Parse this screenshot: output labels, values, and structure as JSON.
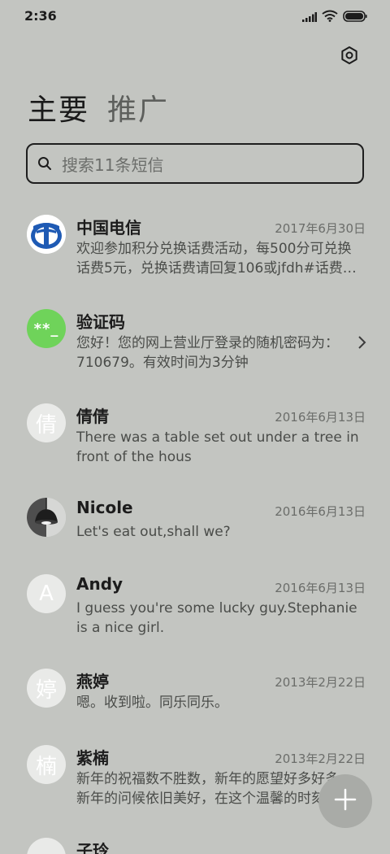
{
  "status_bar": {
    "time": "2:36",
    "icons": [
      "signal-icon",
      "wifi-icon",
      "battery-icon"
    ]
  },
  "header": {
    "settings_icon": "gear-icon"
  },
  "tabs": [
    {
      "label": "主要",
      "active": true
    },
    {
      "label": "推广",
      "active": false
    }
  ],
  "search": {
    "placeholder": "搜索11条短信",
    "icon": "search-icon"
  },
  "messages": [
    {
      "sender": "中国电信",
      "date": "2017年6月30日",
      "line1": "欢迎参加积分兑换话费活动，每500分可兑换",
      "line2": "话费5元，兑换话费请回复106或jfdh#话费…",
      "avatar": {
        "type": "logo",
        "name": "china-telecom-logo"
      }
    },
    {
      "sender": "验证码",
      "date": "",
      "line1": "您好！您的网上营业厅登录的随机密码为：",
      "line2": "710679。有效时间为3分钟",
      "avatar": {
        "type": "code",
        "text": "**_",
        "color": "#6fd35a"
      }
    },
    {
      "sender": "倩倩",
      "date": "2016年6月13日",
      "line1": "There was a table set out under a tree in",
      "line2": "front of the hous",
      "avatar": {
        "type": "letter",
        "text": "倩"
      }
    },
    {
      "sender": "Nicole",
      "date": "2016年6月13日",
      "line1": "Let's eat out,shall we?",
      "line2": "",
      "avatar": {
        "type": "photo",
        "name": "lamp-photo"
      }
    },
    {
      "sender": "Andy",
      "date": "2016年6月13日",
      "line1": "I guess you're some lucky guy.Stephanie",
      "line2": "is a nice girl.",
      "avatar": {
        "type": "letter",
        "text": "A"
      }
    },
    {
      "sender": "燕婷",
      "date": "2013年2月22日",
      "line1": "嗯。收到啦。同乐同乐。",
      "line2": "",
      "avatar": {
        "type": "letter",
        "text": "婷"
      }
    },
    {
      "sender": "紫楠",
      "date": "2013年2月22日",
      "line1": "新年的祝福数不胜数，新年的愿望好多好多，",
      "line2": "新年的问候依旧美好，在这个温馨的时刻，",
      "avatar": {
        "type": "letter",
        "text": "楠"
      }
    },
    {
      "sender": "子玲",
      "date": "",
      "line1": "",
      "line2": "",
      "avatar": {
        "type": "letter",
        "text": ""
      }
    }
  ],
  "fab": {
    "icon": "plus-icon"
  }
}
